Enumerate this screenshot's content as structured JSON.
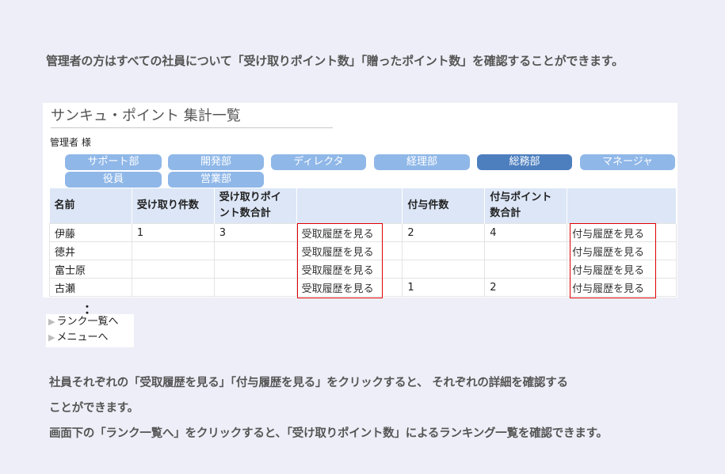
{
  "intro_text": "管理者の方はすべての社員について「受け取りポイント数」「贈ったポイント数」を確認することができます。",
  "panel": {
    "title": "サンキュ・ポイント 集計一覧",
    "user_label": "管理者 様",
    "departments": [
      {
        "label": "サポート部",
        "active": false
      },
      {
        "label": "開発部",
        "active": false
      },
      {
        "label": "ディレクタ",
        "active": false
      },
      {
        "label": "経理部",
        "active": false
      },
      {
        "label": "総務部",
        "active": true
      },
      {
        "label": "マネージャ",
        "active": false
      },
      {
        "label": "役員",
        "active": false
      },
      {
        "label": "営業部",
        "active": false
      }
    ],
    "table": {
      "headers": [
        "名前",
        "受け取り件数",
        "受け取りポイント数合計",
        "",
        "付与件数",
        "付与ポイント数合計",
        ""
      ],
      "rows": [
        [
          "伊藤",
          "1",
          "3",
          "受取履歴を見る",
          "2",
          "4",
          "付与履歴を見る"
        ],
        [
          "徳井",
          "",
          "",
          "受取履歴を見る",
          "",
          "",
          "付与履歴を見る"
        ],
        [
          "富士原",
          "",
          "",
          "受取履歴を見る",
          "",
          "",
          "付与履歴を見る"
        ],
        [
          "古瀬",
          "",
          "",
          "受取履歴を見る",
          "1",
          "2",
          "付与履歴を見る"
        ]
      ]
    }
  },
  "ellipsis": "：",
  "nav": {
    "rank_link": "ランク一覧へ",
    "menu_link": "メニューへ"
  },
  "notes": [
    "社員それぞれの「受取履歴を見る」「付与履歴を見る」をクリックすると、 それぞれの詳細を確認する",
    "ことができます。",
    "画面下の「ランク一覧へ」をクリックすると、「受け取りポイント数」によるランキング一覧を確認できます。"
  ],
  "colors": {
    "dept_button": "#8fb7e8",
    "dept_button_active": "#4d7fbf",
    "table_header": "#dce6f6",
    "highlight_box": "#e00000"
  }
}
